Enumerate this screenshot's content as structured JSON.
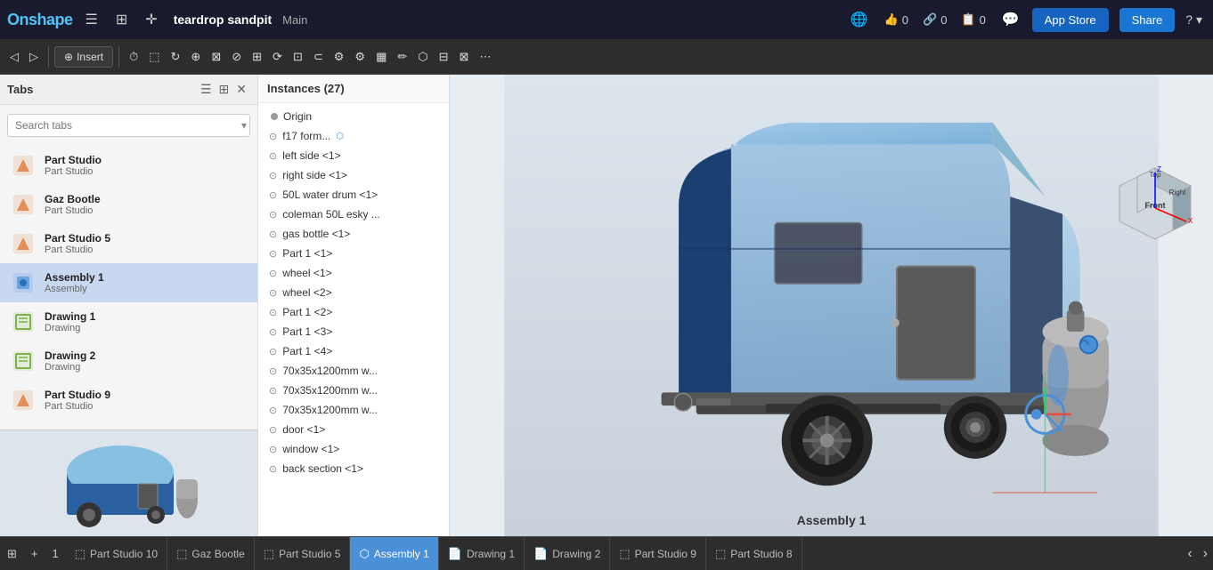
{
  "app": {
    "name": "Onshape",
    "document_title": "teardrop sandpit",
    "branch": "Main"
  },
  "topbar": {
    "stats": [
      {
        "label": "likes",
        "value": "0",
        "icon": "thumb-up"
      },
      {
        "label": "links",
        "value": "0",
        "icon": "link"
      },
      {
        "label": "copies",
        "value": "0",
        "icon": "copy"
      }
    ],
    "appstore_label": "App Store",
    "share_label": "Share",
    "globe_icon": "🌐"
  },
  "toolbar": {
    "insert_label": "Insert",
    "tools": [
      "undo",
      "redo",
      "insert",
      "clock",
      "box",
      "rotate",
      "transform",
      "fix",
      "revolve",
      "pattern",
      "move-face",
      "offset",
      "boolean",
      "part-config",
      "assem-config",
      "parts",
      "sketch",
      "shell",
      "rib",
      "loft"
    ]
  },
  "tabs_panel": {
    "title": "Tabs",
    "search_placeholder": "Search tabs",
    "items": [
      {
        "name": "Part Studio",
        "type": "Part Studio",
        "icon": "partstudio",
        "id": "ps0"
      },
      {
        "name": "Gaz Bootle",
        "type": "Part Studio",
        "icon": "partstudio",
        "id": "ps1"
      },
      {
        "name": "Part Studio 5",
        "type": "Part Studio",
        "icon": "partstudio",
        "id": "ps5"
      },
      {
        "name": "Assembly 1",
        "type": "Assembly",
        "icon": "assembly",
        "id": "asm1",
        "active": true
      },
      {
        "name": "Drawing 1",
        "type": "Drawing",
        "icon": "drawing",
        "id": "drw1"
      },
      {
        "name": "Drawing 2",
        "type": "Drawing",
        "icon": "drawing",
        "id": "drw2"
      },
      {
        "name": "Part Studio 9",
        "type": "Part Studio",
        "icon": "partstudio",
        "id": "ps9"
      }
    ]
  },
  "instances_panel": {
    "title": "Instances",
    "count": 27,
    "items": [
      {
        "name": "Origin",
        "type": "origin"
      },
      {
        "name": "f17 form...",
        "type": "part",
        "has_tag": true
      },
      {
        "name": "left side <1>",
        "type": "part"
      },
      {
        "name": "right side <1>",
        "type": "part"
      },
      {
        "name": "50L water drum <1>",
        "type": "part"
      },
      {
        "name": "coleman 50L esky ...",
        "type": "part"
      },
      {
        "name": "gas bottle <1>",
        "type": "part"
      },
      {
        "name": "Part 1 <1>",
        "type": "part"
      },
      {
        "name": "wheel <1>",
        "type": "part"
      },
      {
        "name": "wheel <2>",
        "type": "part"
      },
      {
        "name": "Part 1 <2>",
        "type": "part"
      },
      {
        "name": "Part 1 <3>",
        "type": "part"
      },
      {
        "name": "Part 1 <4>",
        "type": "part"
      },
      {
        "name": "70x35x1200mm w...",
        "type": "part"
      },
      {
        "name": "70x35x1200mm w...",
        "type": "part"
      },
      {
        "name": "70x35x1200mm w...",
        "type": "part"
      },
      {
        "name": "door <1>",
        "type": "part"
      },
      {
        "name": "window <1>",
        "type": "part"
      },
      {
        "name": "back section <1>",
        "type": "part"
      }
    ]
  },
  "viewport": {
    "assembly_name": "Assembly 1"
  },
  "bottom_bar": {
    "tabs": [
      {
        "label": "Part Studio 10",
        "icon": "partstudio",
        "active": false
      },
      {
        "label": "Gaz Bootle",
        "icon": "partstudio",
        "active": false
      },
      {
        "label": "Part Studio 5",
        "icon": "partstudio",
        "active": false
      },
      {
        "label": "Assembly 1",
        "icon": "assembly",
        "active": true
      },
      {
        "label": "Drawing 1",
        "icon": "drawing",
        "active": false
      },
      {
        "label": "Drawing 2",
        "icon": "drawing",
        "active": false
      },
      {
        "label": "Part Studio 9",
        "icon": "partstudio",
        "active": false
      },
      {
        "label": "Part Studio 8",
        "icon": "partstudio",
        "active": false
      }
    ]
  },
  "colors": {
    "accent_blue": "#1976d2",
    "active_tab": "#4a90d9",
    "topbar_bg": "#1a1a2e",
    "toolbar_bg": "#2d2d2d"
  }
}
